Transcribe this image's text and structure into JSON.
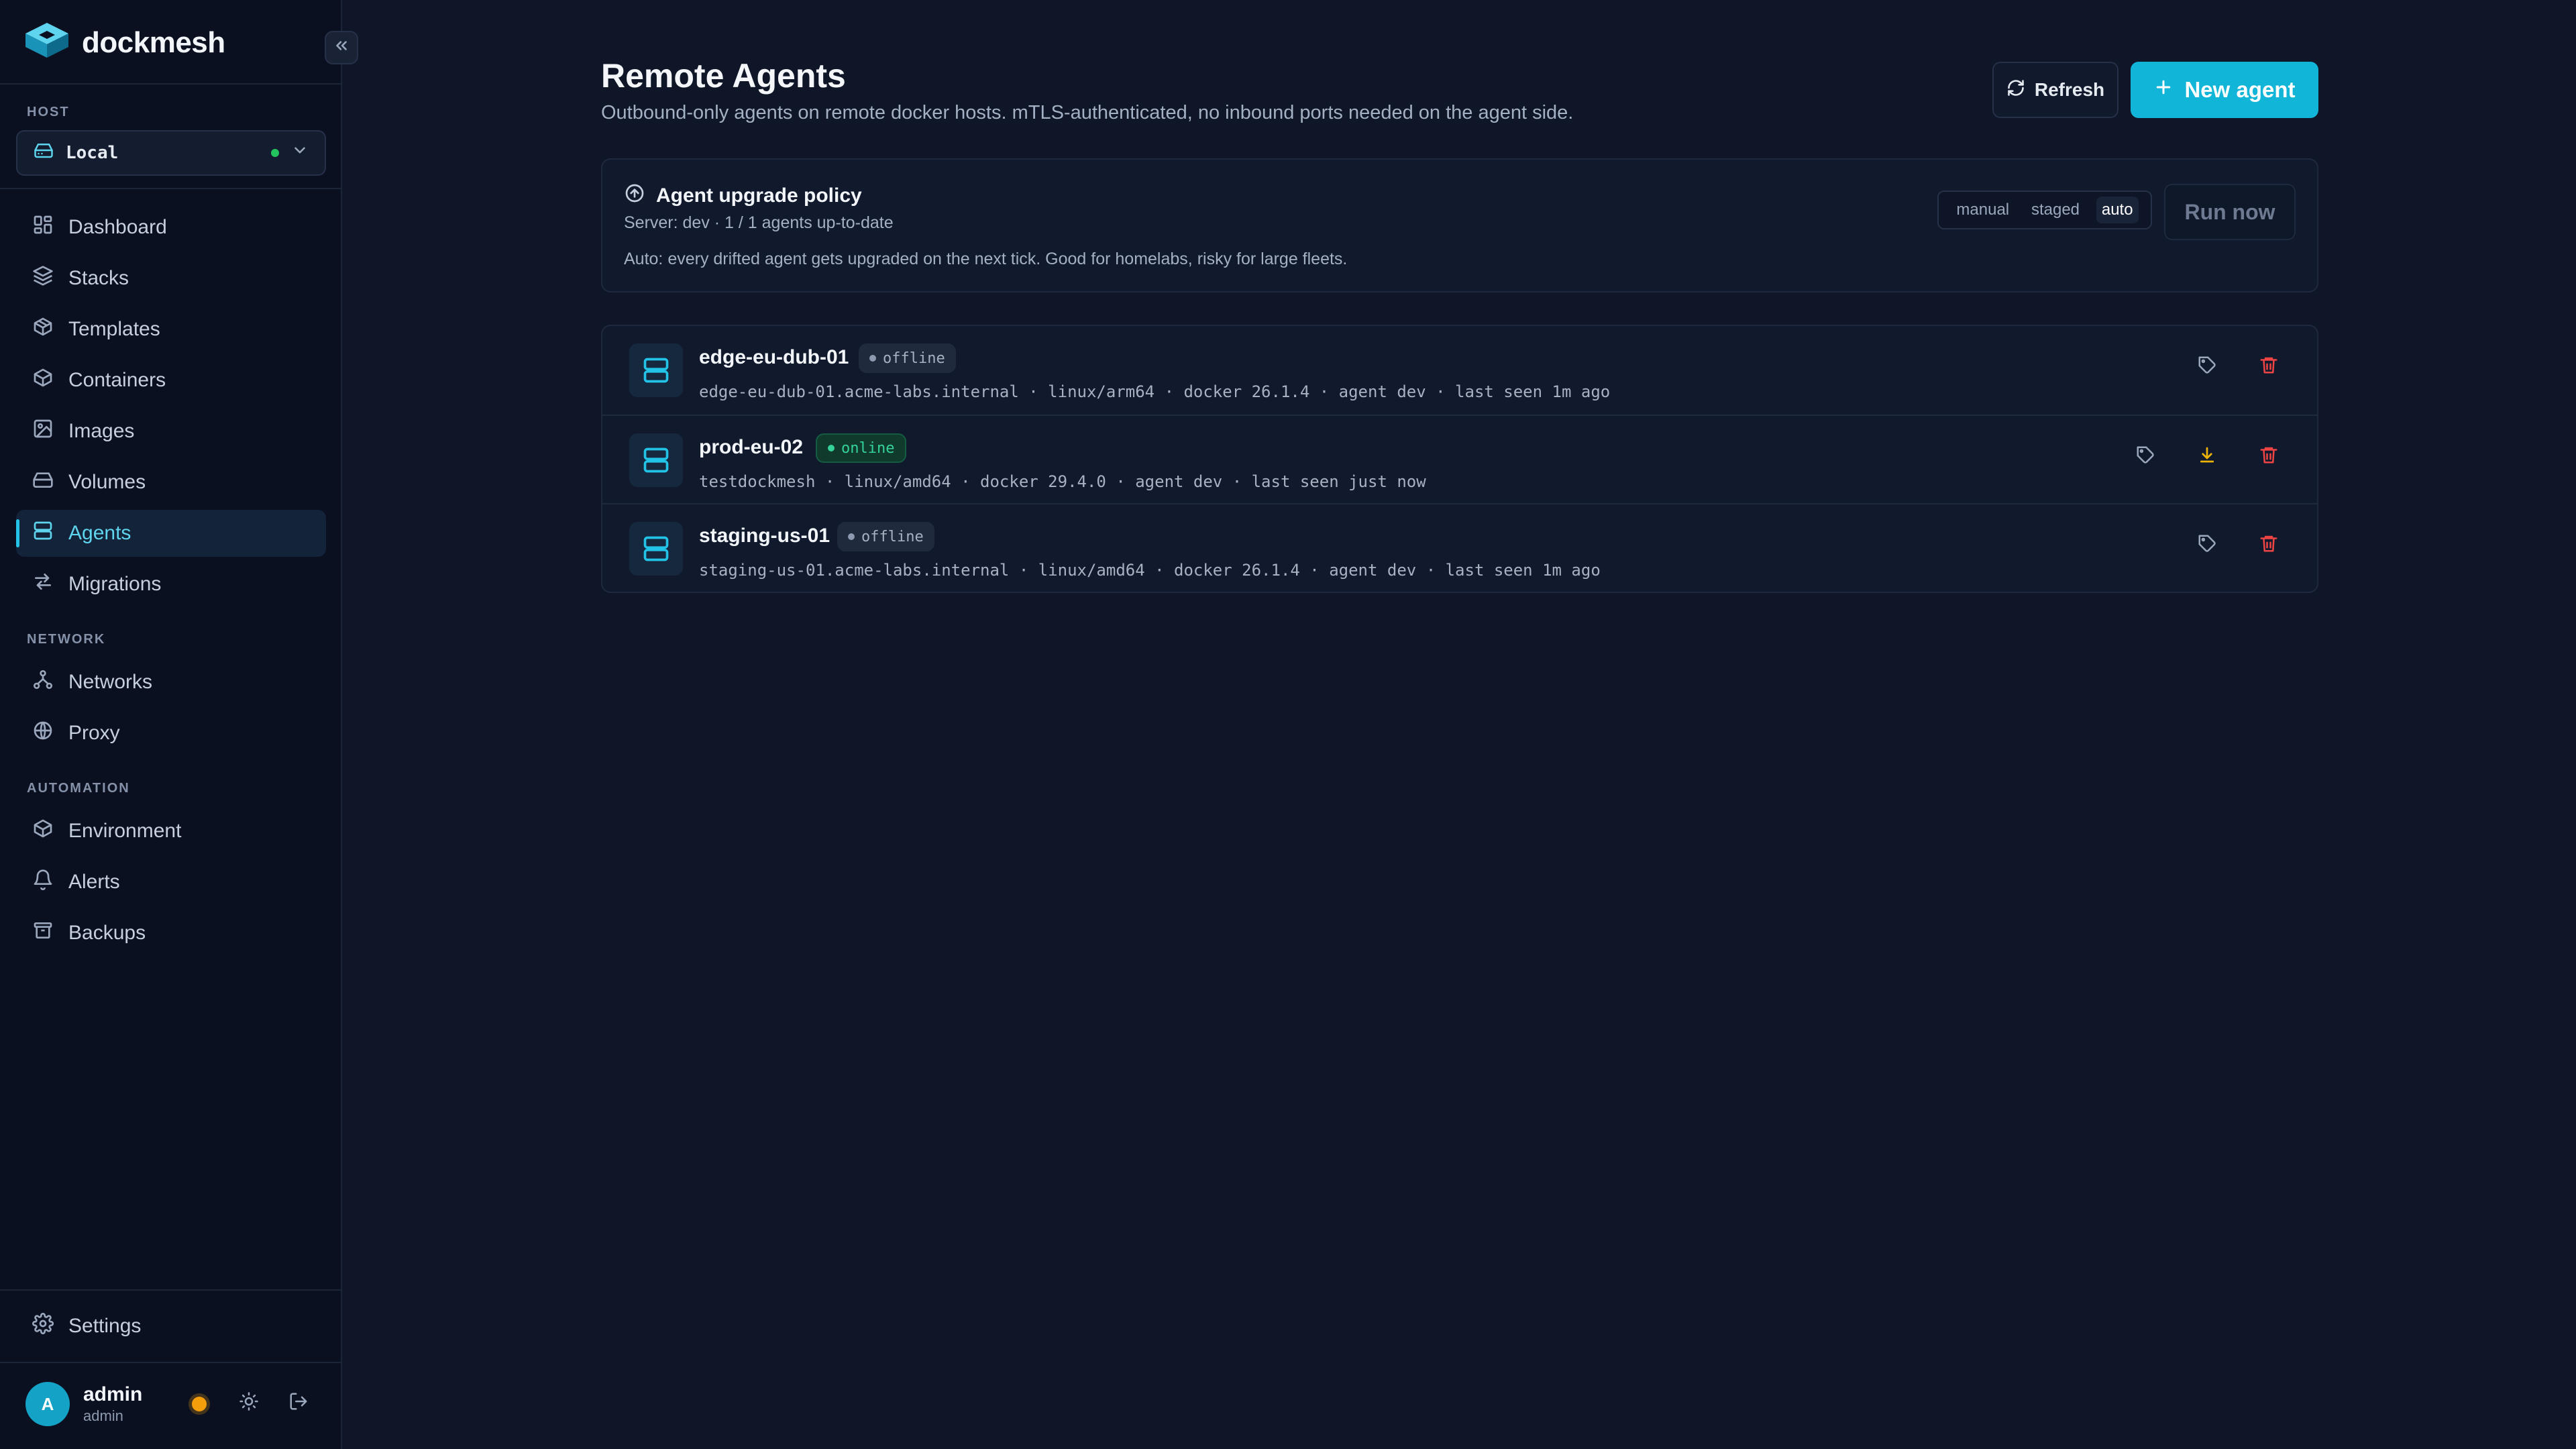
{
  "app": {
    "brand_name": "dockmesh",
    "collapse_icon": "double-chevron-left-icon"
  },
  "sidebar": {
    "host_label": "HOST",
    "host_value": "Local",
    "host_status_color": "#22c55e",
    "nav_main": [
      {
        "label": "Dashboard",
        "icon": "dashboard-icon"
      },
      {
        "label": "Stacks",
        "icon": "layers-icon"
      },
      {
        "label": "Templates",
        "icon": "package-icon"
      },
      {
        "label": "Containers",
        "icon": "box-icon"
      },
      {
        "label": "Images",
        "icon": "image-icon"
      },
      {
        "label": "Volumes",
        "icon": "hard-drive-icon"
      },
      {
        "label": "Agents",
        "icon": "server-icon",
        "active": true
      },
      {
        "label": "Migrations",
        "icon": "arrows-swap-icon"
      }
    ],
    "network_label": "NETWORK",
    "nav_network": [
      {
        "label": "Networks",
        "icon": "network-icon"
      },
      {
        "label": "Proxy",
        "icon": "globe-icon"
      }
    ],
    "automation_label": "AUTOMATION",
    "nav_automation": [
      {
        "label": "Environment",
        "icon": "box-icon"
      },
      {
        "label": "Alerts",
        "icon": "bell-icon"
      },
      {
        "label": "Backups",
        "icon": "archive-icon"
      }
    ],
    "settings_label": "Settings",
    "user": {
      "avatar_letter": "A",
      "name": "admin",
      "role": "admin"
    }
  },
  "header": {
    "title": "Remote Agents",
    "subtitle": "Outbound-only agents on remote docker hosts. mTLS-authenticated, no inbound ports needed on the agent side.",
    "refresh_label": "Refresh",
    "new_agent_label": "New agent",
    "accent_color": "#11b5d8"
  },
  "policy": {
    "title": "Agent upgrade policy",
    "status": "Server: dev · 1 / 1 agents up-to-date",
    "description": "Auto: every drifted agent gets upgraded on the next tick. Good for homelabs, risky for large fleets.",
    "modes": [
      "manual",
      "staged",
      "auto"
    ],
    "selected_mode": "auto",
    "run_now_label": "Run now"
  },
  "agents": [
    {
      "name": "edge-eu-dub-01",
      "status": "offline",
      "meta": "edge-eu-dub-01.acme-labs.internal · linux/arm64 · docker 26.1.4 · agent dev · last seen 1m ago",
      "has_upgrade": false
    },
    {
      "name": "prod-eu-02",
      "status": "online",
      "meta": "testdockmesh · linux/amd64 · docker 29.4.0 · agent dev · last seen just now",
      "has_upgrade": true
    },
    {
      "name": "staging-us-01",
      "status": "offline",
      "meta": "staging-us-01.acme-labs.internal · linux/amd64 · docker 26.1.4 · agent dev · last seen 1m ago",
      "has_upgrade": false
    }
  ],
  "colors": {
    "online": "#34d399",
    "offline": "#8d99ae",
    "delete": "#ef4444",
    "upgrade": "#eab308"
  }
}
